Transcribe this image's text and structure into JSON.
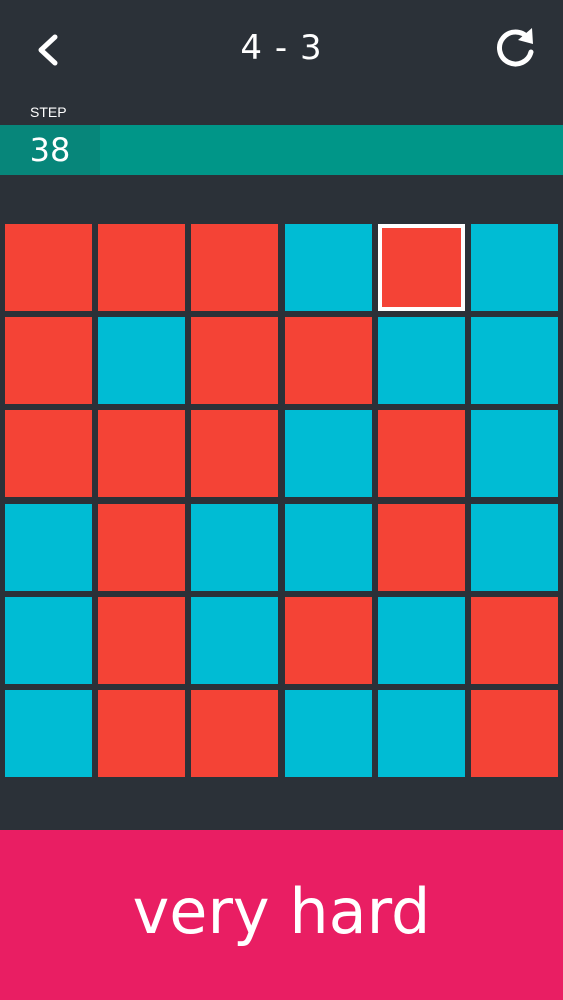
{
  "header": {
    "back_icon": "chevron-left-icon",
    "level": "4 - 3",
    "refresh_icon": "refresh-icon"
  },
  "step": {
    "label": "STEP",
    "count": "38"
  },
  "board": {
    "rows": 6,
    "cols": 6,
    "colors": {
      "red": "#f44336",
      "blue": "#00bcd4",
      "selected_border": "#ffffff"
    },
    "selected": [
      0,
      4
    ],
    "tiles": [
      [
        "red",
        "red",
        "red",
        "blue",
        "red",
        "blue"
      ],
      [
        "red",
        "blue",
        "red",
        "red",
        "blue",
        "blue"
      ],
      [
        "red",
        "red",
        "red",
        "blue",
        "red",
        "blue"
      ],
      [
        "blue",
        "red",
        "blue",
        "blue",
        "red",
        "blue"
      ],
      [
        "blue",
        "red",
        "blue",
        "red",
        "blue",
        "red"
      ],
      [
        "blue",
        "red",
        "red",
        "blue",
        "blue",
        "red"
      ]
    ]
  },
  "difficulty": {
    "label": "very hard",
    "color": "#e91e63"
  },
  "theme": {
    "background": "#2b3138",
    "step_bar": "#009688",
    "step_count_bg": "#07867a"
  }
}
